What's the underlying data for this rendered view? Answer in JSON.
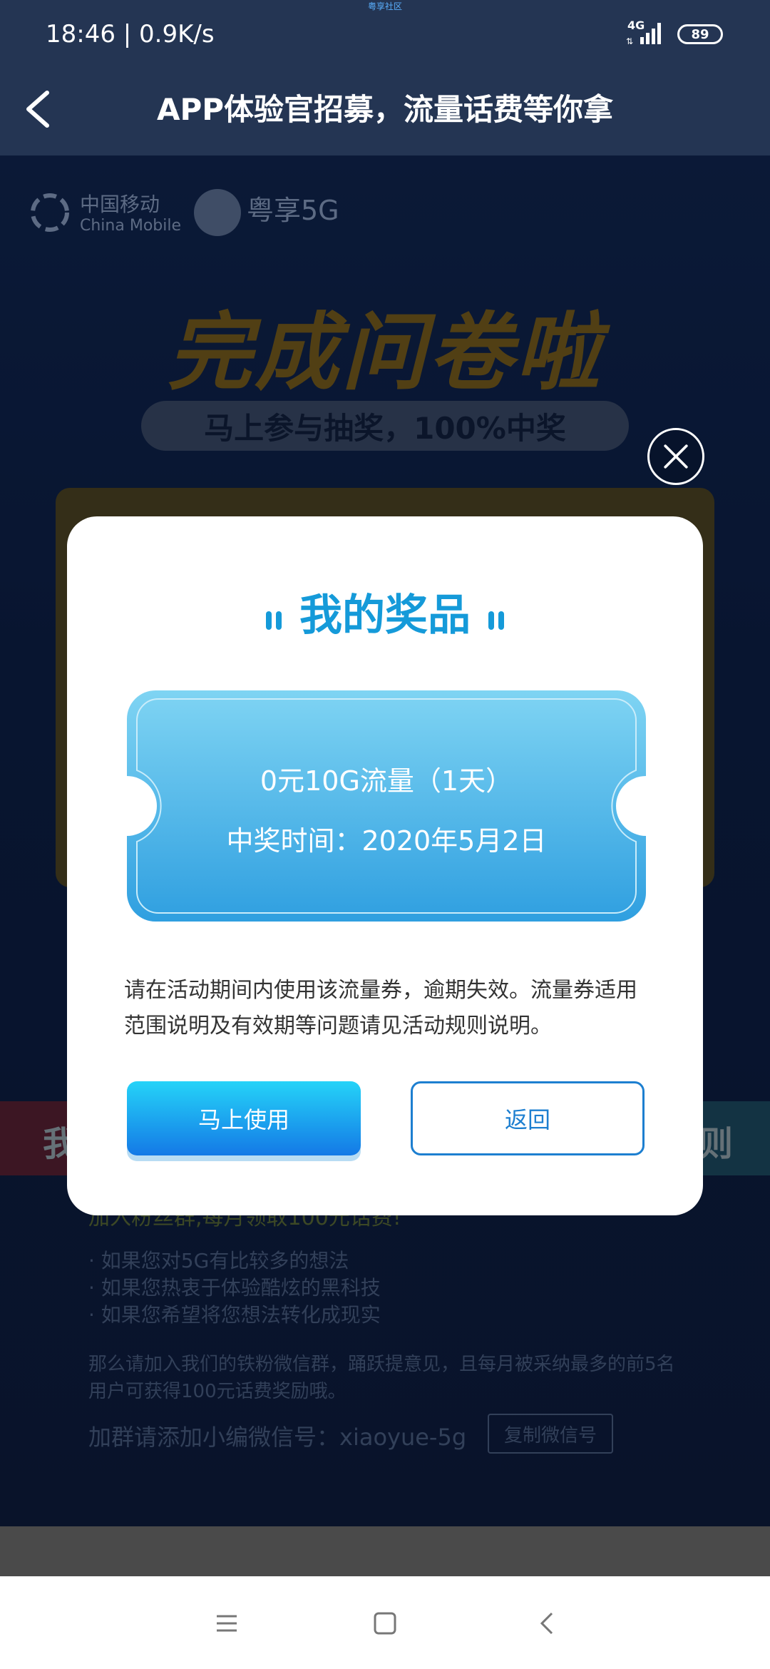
{
  "status_bar": {
    "time": "18:46 | 0.9K/s",
    "tiny_top": "粤享社区",
    "network": "4G",
    "battery": "89"
  },
  "header": {
    "title": "APP体验官招募，流量话费等你拿"
  },
  "background_page": {
    "brand_cm": "中国移动",
    "brand_cm_en": "China Mobile",
    "brand_app": "粤享5G",
    "headline": "完成问卷啦",
    "pill": "马上参与抽奖，100%中奖",
    "left_tab": "我",
    "right_tab": "则",
    "fans_title": "加入粉丝群,每月领取100元话费!",
    "fans_items": [
      "· 如果您对5G有比较多的想法",
      "· 如果您热衷于体验酷炫的黑科技",
      "· 如果您希望将您想法转化成现实"
    ],
    "fans_paragraph": "那么请加入我们的铁粉微信群，踊跃提意见，且每月被采纳最多的前5名用户可获得100元话费奖励哦。",
    "wechat_line": "加群请添加小编微信号：xiaoyue-5g",
    "copy_button": "复制微信号"
  },
  "modal": {
    "title": "我的奖品",
    "prize_name": "0元10G流量（1天）",
    "prize_time": "中奖时间：2020年5月2日",
    "description": "请在活动期间内使用该流量券，逾期失效。流量券适用范围说明及有效期等问题请见活动规则说明。",
    "use_button": "马上使用",
    "back_button": "返回"
  },
  "colors": {
    "accent": "#159ad9",
    "ticket": "#3fb3e8",
    "header_bg": "#243553"
  }
}
